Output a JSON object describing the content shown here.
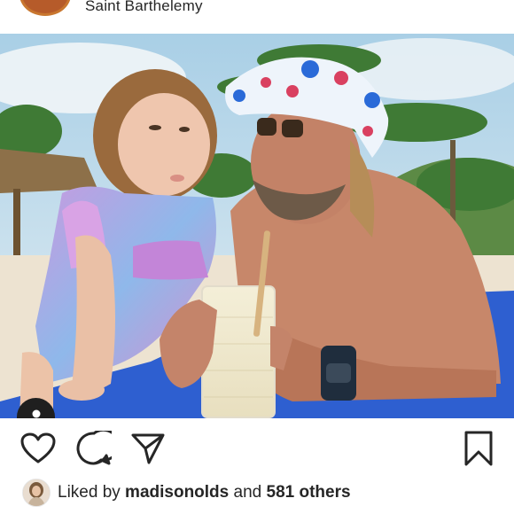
{
  "post_header": {
    "location": "Saint Barthelemy"
  },
  "photo": {
    "alt_semantic": "beach-photo"
  },
  "actions": {
    "like_icon": "heart-icon",
    "comment_icon": "comment-icon",
    "share_icon": "paper-plane-icon",
    "save_icon": "bookmark-icon",
    "tag_icon": "person-icon"
  },
  "likes": {
    "prefix": "Liked by ",
    "user": "madisonolds",
    "middle": " and ",
    "count": "581 others"
  },
  "colors": {
    "text": "#262626",
    "towel": "#2e5fd0",
    "avatar_ring": "#c9772f"
  }
}
